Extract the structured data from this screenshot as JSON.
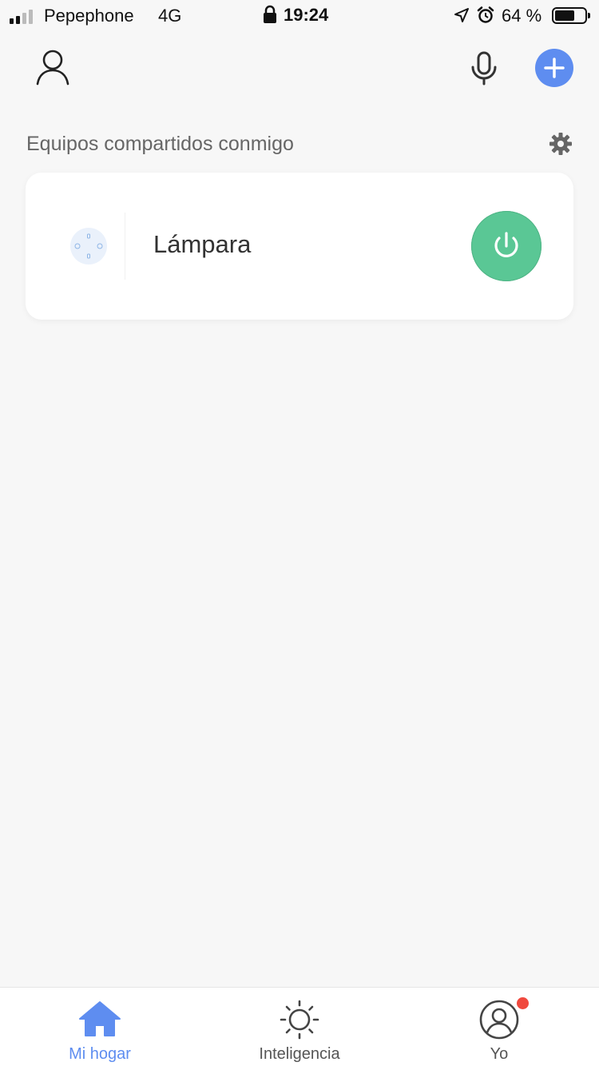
{
  "status_bar": {
    "carrier": "Pepephone",
    "network": "4G",
    "time": "19:24",
    "battery_percent": "64 %",
    "battery_level": 0.64
  },
  "header": {
    "profile_icon": "person-outline-icon",
    "mic_icon": "microphone-icon",
    "add_icon": "plus-icon",
    "accent_color": "#5e8df0"
  },
  "section": {
    "title": "Equipos compartidos conmigo",
    "settings_icon": "gear-icon"
  },
  "devices": [
    {
      "name": "Lámpara",
      "icon": "smart-plug-icon",
      "power_icon": "power-icon",
      "power_color": "#5ac795",
      "on": true
    }
  ],
  "tab_bar": {
    "tabs": [
      {
        "label": "Mi hogar",
        "icon": "home-icon",
        "active": true
      },
      {
        "label": "Inteligencia",
        "icon": "sun-icon",
        "active": false
      },
      {
        "label": "Yo",
        "icon": "user-circle-icon",
        "active": false,
        "badge": true
      }
    ],
    "badge_color": "#f0493e"
  }
}
